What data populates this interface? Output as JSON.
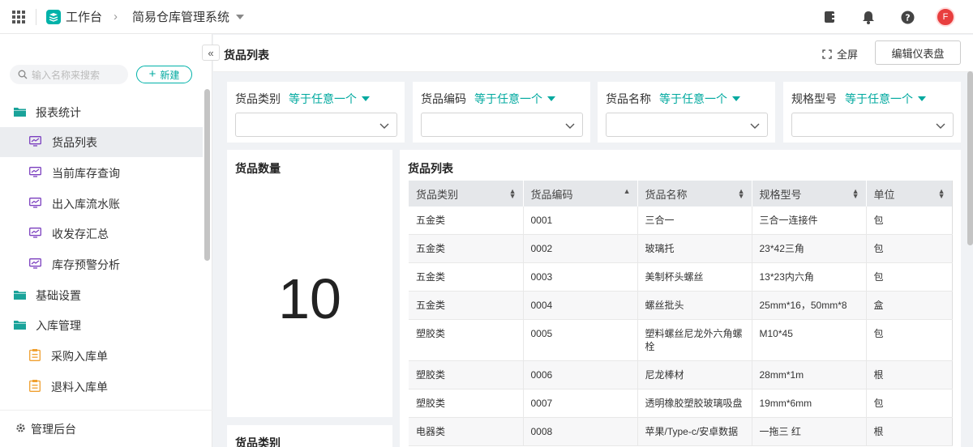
{
  "topbar": {
    "app_name": "工作台",
    "system_name": "简易仓库管理系统",
    "avatar_letter": "F"
  },
  "sidebar": {
    "search_placeholder": "输入名称来搜索",
    "new_label": "新建",
    "items": [
      {
        "label": "报表统计",
        "type": "group"
      },
      {
        "label": "货品列表",
        "type": "sub",
        "active": true
      },
      {
        "label": "当前库存查询",
        "type": "sub"
      },
      {
        "label": "出入库流水账",
        "type": "sub"
      },
      {
        "label": "收发存汇总",
        "type": "sub"
      },
      {
        "label": "库存预警分析",
        "type": "sub"
      },
      {
        "label": "基础设置",
        "type": "group"
      },
      {
        "label": "入库管理",
        "type": "group"
      },
      {
        "label": "采购入库单",
        "type": "sub"
      },
      {
        "label": "退料入库单",
        "type": "sub"
      }
    ],
    "admin_label": "管理后台"
  },
  "header": {
    "title": "货品列表",
    "fullscreen_label": "全屏",
    "edit_label": "编辑仪表盘"
  },
  "filters": [
    {
      "label": "货品类别",
      "op": "等于任意一个"
    },
    {
      "label": "货品编码",
      "op": "等于任意一个"
    },
    {
      "label": "货品名称",
      "op": "等于任意一个"
    },
    {
      "label": "规格型号",
      "op": "等于任意一个"
    }
  ],
  "count_card": {
    "title": "货品数量",
    "value": "10"
  },
  "type_card": {
    "title": "货品类别"
  },
  "table": {
    "title": "货品列表",
    "columns": [
      "货品类别",
      "货品编码",
      "货品名称",
      "规格型号",
      "单位"
    ],
    "rows": [
      [
        "五金类",
        "0001",
        "三合一",
        "三合一连接件",
        "包"
      ],
      [
        "五金类",
        "0002",
        "玻璃托",
        "23*42三角",
        "包"
      ],
      [
        "五金类",
        "0003",
        "美制杯头螺丝",
        "13*23内六角",
        "包"
      ],
      [
        "五金类",
        "0004",
        "螺丝批头",
        "25mm*16，50mm*8",
        "盒"
      ],
      [
        "塑胶类",
        "0005",
        "塑料螺丝尼龙外六角螺栓",
        "M10*45",
        "包"
      ],
      [
        "塑胶类",
        "0006",
        "尼龙棒材",
        "28mm*1m",
        "根"
      ],
      [
        "塑胶类",
        "0007",
        "透明橡胶塑胶玻璃吸盘",
        "19mm*6mm",
        "包"
      ],
      [
        "电器类",
        "0008",
        "苹果/Type-c/安卓数据",
        "一拖三 红",
        "根"
      ]
    ]
  },
  "colors": {
    "accent": "#00b2a9",
    "folder": "#1aa39a",
    "report_icon": "#7b3fbf",
    "doc_icon": "#f0a030",
    "avatar": "#e83e3e"
  }
}
